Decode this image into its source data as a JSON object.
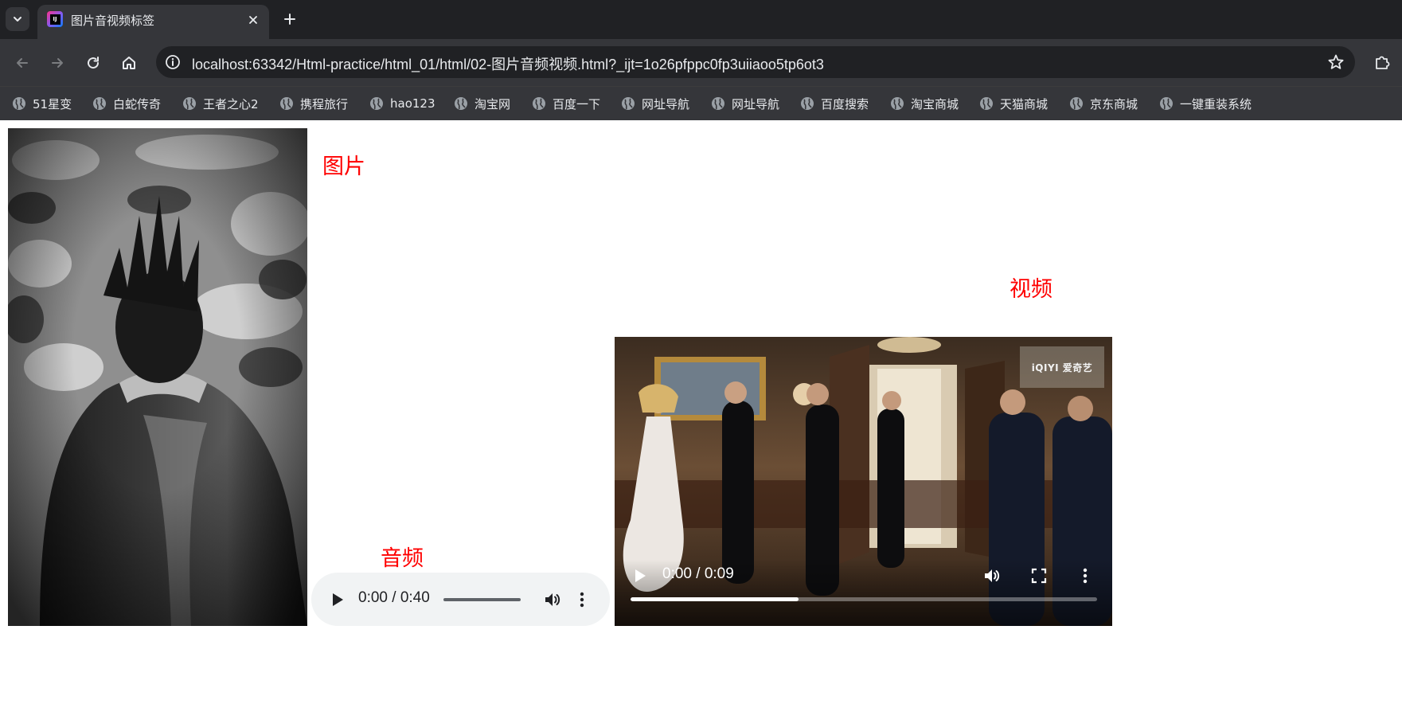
{
  "tab": {
    "title": "图片音视频标签",
    "favicon": "jetbrains-icon"
  },
  "omnibox": {
    "url": "localhost:63342/Html-practice/html_01/html/02-图片音频视频.html?_ijt=1o26pfppc0fp3uiiaoo5tp6ot3"
  },
  "bookmarks": [
    {
      "label": "51星变"
    },
    {
      "label": "白蛇传奇"
    },
    {
      "label": "王者之心2"
    },
    {
      "label": "携程旅行"
    },
    {
      "label": "hao123"
    },
    {
      "label": "淘宝网"
    },
    {
      "label": "百度一下"
    },
    {
      "label": "网址导航"
    },
    {
      "label": "网址导航"
    },
    {
      "label": "百度搜索"
    },
    {
      "label": "淘宝商城"
    },
    {
      "label": "天猫商城"
    },
    {
      "label": "京东商城"
    },
    {
      "label": "一键重装系统"
    }
  ],
  "page": {
    "image_label": "图片",
    "audio_label": "音频",
    "video_label": "视频",
    "label_color": "#ff0000"
  },
  "audio": {
    "time": "0:00 / 0:40"
  },
  "video": {
    "time": "0:00 / 0:09",
    "watermark": "iQIYI 爱奇艺",
    "progress_buffered": 0.36
  },
  "colors": {
    "chrome_dark": "#202124",
    "chrome_toolbar": "#35363a",
    "chrome_text": "#e8eaed",
    "audio_bg": "#f1f3f4"
  }
}
